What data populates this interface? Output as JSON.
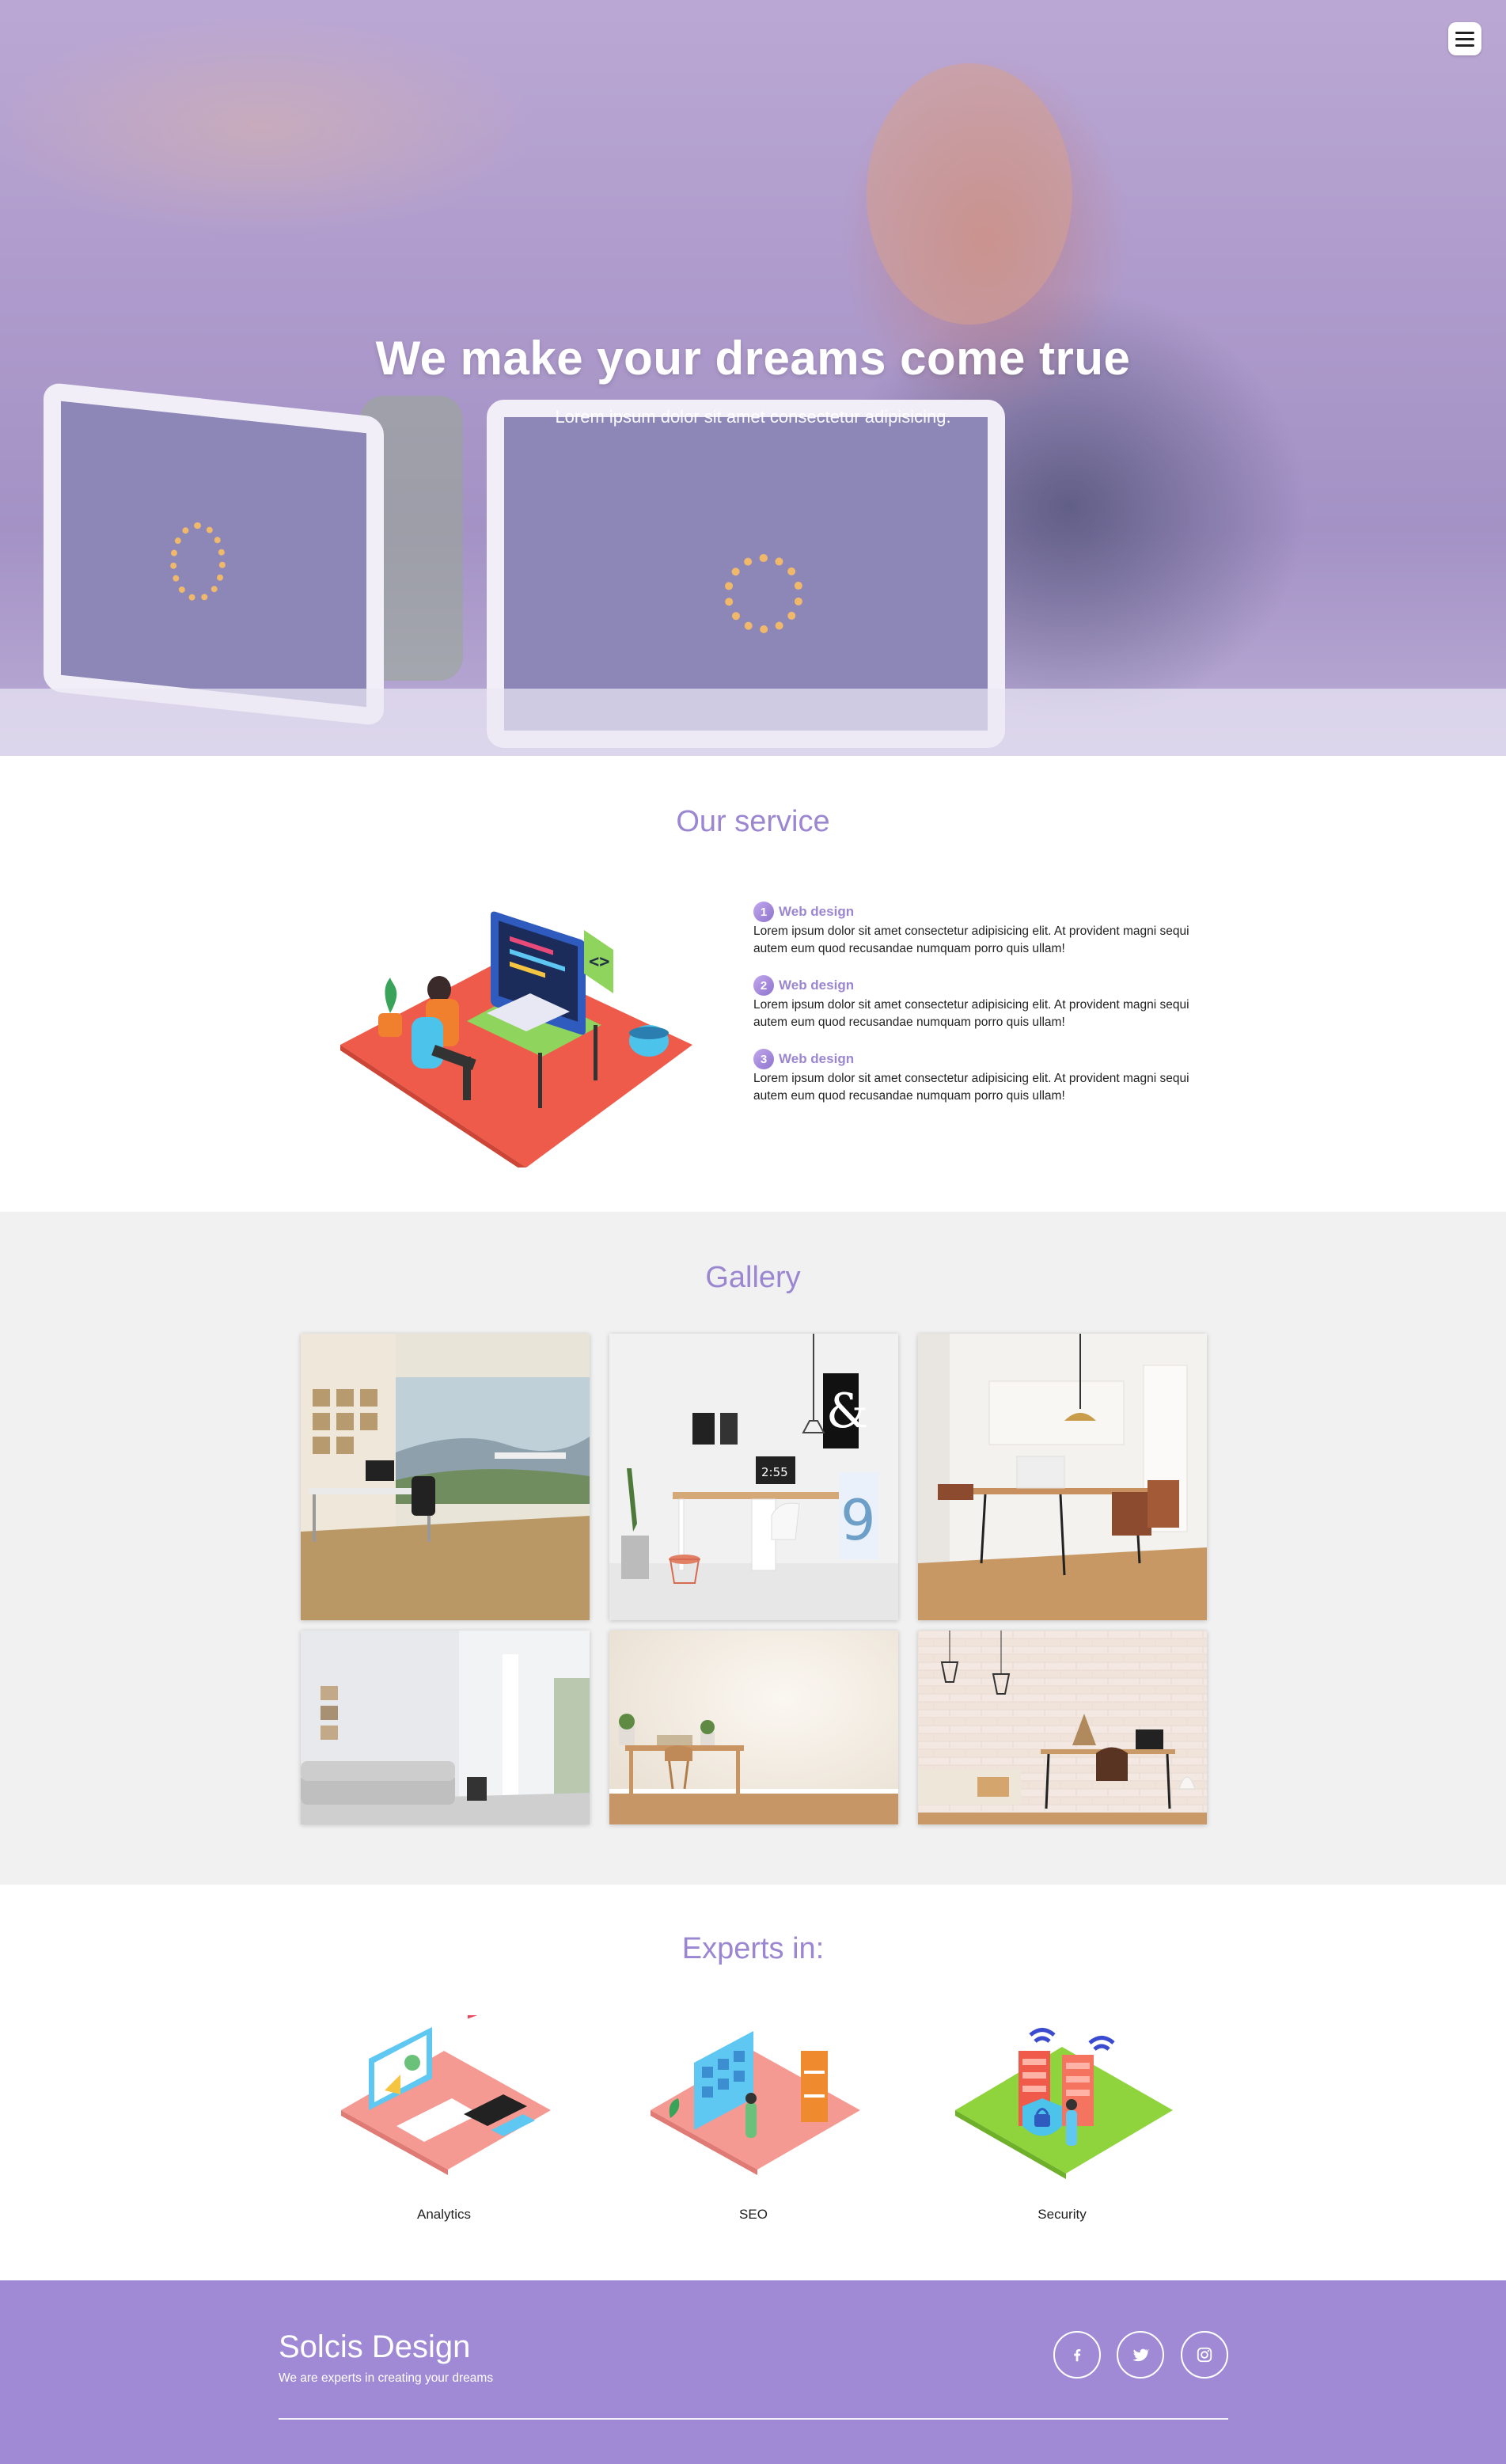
{
  "hero": {
    "title": "We make your dreams come true",
    "subtitle": "Lorem ipsum dolor sit amet consectetur adipisicing.",
    "menu_icon": "hamburger-icon",
    "overlay_color": "#9b86d1"
  },
  "service": {
    "title": "Our service",
    "illustration": "developer-at-desk-illustration",
    "items": [
      {
        "num": "1",
        "heading": "Web design",
        "text": "Lorem ipsum dolor sit amet consectetur adipisicing elit. At provident magni sequi autem eum quod recusandae numquam porro quis ullam!"
      },
      {
        "num": "2",
        "heading": "Web design",
        "text": "Lorem ipsum dolor sit amet consectetur adipisicing elit. At provident magni sequi autem eum quod recusandae numquam porro quis ullam!"
      },
      {
        "num": "3",
        "heading": "Web design",
        "text": "Lorem ipsum dolor sit amet consectetur adipisicing elit. At provident magni sequi autem eum quod recusandae numquam porro quis ullam!"
      }
    ]
  },
  "gallery": {
    "title": "Gallery",
    "images": [
      "office-with-mountain-view",
      "white-desk-with-ampersand-poster",
      "dining-table-with-pendant-lamp",
      "white-room-with-sofa",
      "empty-room-with-small-desk",
      "brick-wall-workspace"
    ]
  },
  "experts": {
    "title": "Experts in:",
    "items": [
      {
        "label": "Analytics",
        "icon": "analytics-illustration"
      },
      {
        "label": "SEO",
        "icon": "seo-illustration"
      },
      {
        "label": "Security",
        "icon": "security-illustration"
      }
    ]
  },
  "footer": {
    "brand": "Solcis Design",
    "tagline": "We are experts in creating your dreams",
    "social": [
      "facebook-icon",
      "twitter-icon",
      "instagram-icon"
    ],
    "background": "#a08ad5"
  },
  "colors": {
    "accent": "#9b86d1",
    "gallery_bg": "#f1f1f1"
  }
}
